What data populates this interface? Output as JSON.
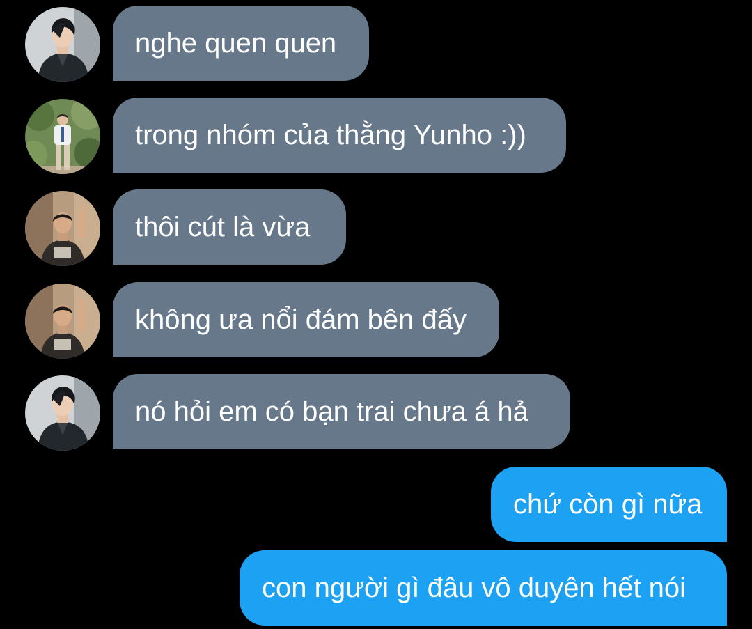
{
  "colors": {
    "background": "#000000",
    "incoming_bubble": "#66788a",
    "outgoing_bubble": "#1da1f2",
    "text": "#ffffff"
  },
  "messages": [
    {
      "side": "incoming",
      "avatar": "avatar-photo-man-dark-shirt-icon",
      "text": "nghe quen quen"
    },
    {
      "side": "incoming",
      "avatar": "avatar-photo-man-garden-icon",
      "text": "trong nhóm của thằng Yunho :))"
    },
    {
      "side": "incoming",
      "avatar": "avatar-photo-man-peace-sign-icon",
      "text": "thôi cút là vừa"
    },
    {
      "side": "incoming",
      "avatar": "avatar-photo-man-peace-sign-icon",
      "text": "không ưa nổi đám bên đấy"
    },
    {
      "side": "incoming",
      "avatar": "avatar-photo-man-dark-shirt-icon",
      "text": "nó hỏi em có bạn trai chưa á hả"
    },
    {
      "side": "outgoing",
      "text": "chứ còn gì nữa"
    },
    {
      "side": "outgoing",
      "text": "con người gì đâu vô duyên hết nói"
    }
  ]
}
